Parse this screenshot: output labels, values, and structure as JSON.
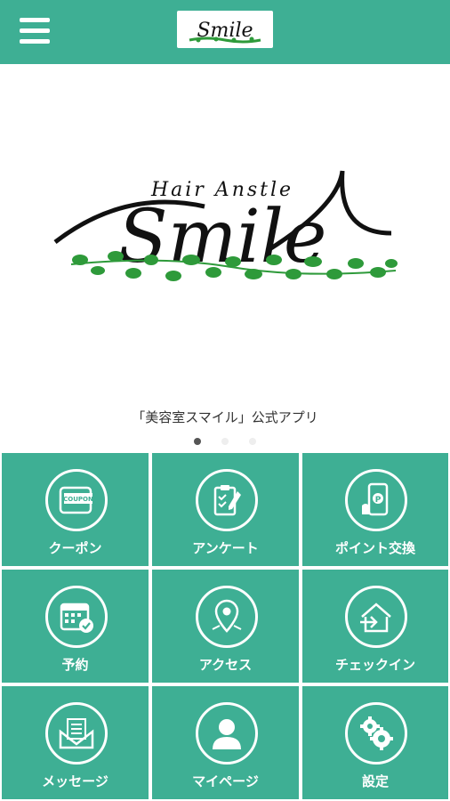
{
  "header": {
    "menu_icon": "hamburger-icon",
    "logo_text": "Smile"
  },
  "hero": {
    "logo_small": "Hair Anstle",
    "logo_big": "Smile",
    "tagline": "「美容室スマイル」公式アプリ",
    "carousel": {
      "count": 3,
      "active": 0
    }
  },
  "menu": [
    {
      "label": "クーポン",
      "icon": "coupon-icon"
    },
    {
      "label": "アンケート",
      "icon": "clipboard-icon"
    },
    {
      "label": "ポイント交換",
      "icon": "phone-point-icon"
    },
    {
      "label": "予約",
      "icon": "calendar-check-icon"
    },
    {
      "label": "アクセス",
      "icon": "map-pin-icon"
    },
    {
      "label": "チェックイン",
      "icon": "checkin-icon"
    },
    {
      "label": "メッセージ",
      "icon": "envelope-icon"
    },
    {
      "label": "マイページ",
      "icon": "user-icon"
    },
    {
      "label": "設定",
      "icon": "gear-icon"
    }
  ],
  "colors": {
    "primary": "#3eaf94",
    "leaf": "#2e9a3a",
    "text": "#333333"
  }
}
